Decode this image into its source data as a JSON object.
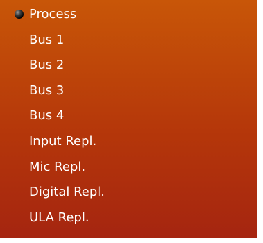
{
  "menu": {
    "selected_index": 0,
    "items": [
      {
        "label": "Process",
        "selected": true
      },
      {
        "label": "Bus 1",
        "selected": false
      },
      {
        "label": "Bus 2",
        "selected": false
      },
      {
        "label": "Bus 3",
        "selected": false
      },
      {
        "label": "Bus 4",
        "selected": false
      },
      {
        "label": "Input Repl.",
        "selected": false
      },
      {
        "label": "Mic Repl.",
        "selected": false
      },
      {
        "label": "Digital Repl.",
        "selected": false
      },
      {
        "label": "ULA Repl.",
        "selected": false
      }
    ]
  },
  "colors": {
    "panel_top": "#c85608",
    "panel_bottom": "#a52510",
    "text": "#ffffff",
    "selected_indicator": "#000000"
  },
  "icons": {
    "selected_indicator": "radio-dot-icon"
  }
}
